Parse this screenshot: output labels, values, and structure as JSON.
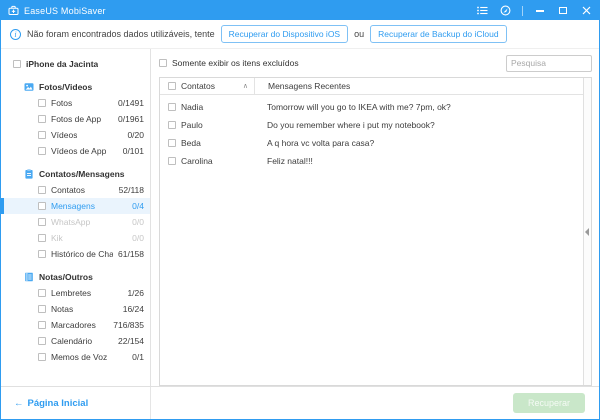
{
  "window": {
    "title": "EaseUS MobiSaver"
  },
  "icons": {
    "info": "i",
    "sort_asc": "∧",
    "back": "←",
    "app_logo": "toolbox-icon",
    "titlebar_menu": "menu-list-icon",
    "titlebar_globe": "globe-icon",
    "minimize": "minimize-icon",
    "maximize": "maximize-icon",
    "close": "close-icon",
    "splitter": "collapse-left-arrow-icon"
  },
  "colors": {
    "accent_blue": "#2F9CF0",
    "selected_item_bg": "#EAF4FD",
    "disabled_text": "#C6C6C6",
    "recover_disabled_bg": "#C9E7C9"
  },
  "notification": {
    "text": "Não foram encontrados dados utilizáveis, tente",
    "button_ios": "Recuperar do Dispositivo iOS",
    "separator": "ou",
    "button_icloud": "Recuperar de Backup do iCloud"
  },
  "sidebar": {
    "device": {
      "label": "iPhone da Jacinta"
    },
    "sections": [
      {
        "label": "Fotos/Videos",
        "icon": "photos-icon",
        "items": [
          {
            "label": "Fotos",
            "count": "0/1491"
          },
          {
            "label": "Fotos de App",
            "count": "0/1961"
          },
          {
            "label": "Vídeos",
            "count": "0/20"
          },
          {
            "label": "Vídeos de App",
            "count": "0/101"
          }
        ]
      },
      {
        "label": "Contatos/Mensagens",
        "icon": "contacts-icon",
        "items": [
          {
            "label": "Contatos",
            "count": "52/118"
          },
          {
            "label": "Mensagens",
            "count": "0/4",
            "selected": true
          },
          {
            "label": "WhatsApp",
            "count": "0/0",
            "disabled": true
          },
          {
            "label": "Kik",
            "count": "0/0",
            "disabled": true
          },
          {
            "label": "Histórico de Chamadas",
            "count": "61/158"
          }
        ]
      },
      {
        "label": "Notas/Outros",
        "icon": "notes-icon",
        "items": [
          {
            "label": "Lembretes",
            "count": "1/26"
          },
          {
            "label": "Notas",
            "count": "16/24"
          },
          {
            "label": "Marcadores",
            "count": "716/835"
          },
          {
            "label": "Calendário",
            "count": "22/154"
          },
          {
            "label": "Memos de Voz",
            "count": "0/1"
          }
        ]
      }
    ]
  },
  "main": {
    "filter_label": "Somente exibir os itens excluídos",
    "search_placeholder": "Pesquisa",
    "table": {
      "columns": [
        "Contatos",
        "Mensagens Recentes"
      ],
      "rows": [
        {
          "contact": "Nadia",
          "message": "Tomorrow will you go to IKEA with me? 7pm, ok?"
        },
        {
          "contact": "Paulo",
          "message": "Do you remember where i put my notebook?"
        },
        {
          "contact": "Beda",
          "message": "A q hora vc volta para casa?"
        },
        {
          "contact": "Carolina",
          "message": "Feliz natal!!!"
        }
      ]
    }
  },
  "footer": {
    "home_link": "Página Inicial",
    "recover_button": "Recuperar"
  }
}
